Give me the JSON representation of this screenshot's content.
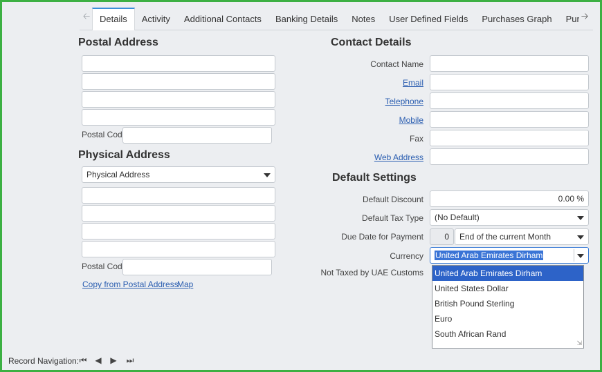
{
  "tabs": [
    "Details",
    "Activity",
    "Additional Contacts",
    "Banking Details",
    "Notes",
    "User Defined Fields",
    "Purchases Graph",
    "Purchase O"
  ],
  "postal": {
    "heading": "Postal Address",
    "postal_code_label": "Postal Code"
  },
  "physical": {
    "heading": "Physical Address",
    "select_value": "Physical Address",
    "postal_code_label": "Postal Code",
    "copy_link": "Copy from Postal Address",
    "map_link": "Map"
  },
  "contact": {
    "heading": "Contact Details",
    "contact_name_label": "Contact Name",
    "email_label": "Email",
    "telephone_label": "Telephone",
    "mobile_label": "Mobile",
    "fax_label": "Fax",
    "web_label": "Web Address"
  },
  "defaults": {
    "heading": "Default Settings",
    "discount_label": "Default Discount",
    "discount_value": "0.00 %",
    "tax_label": "Default Tax Type",
    "tax_value": "(No Default)",
    "due_label": "Due Date for Payment",
    "due_days": "0",
    "due_value": "End of the current Month",
    "currency_label": "Currency",
    "currency_value": "United Arab Emirates Dirham",
    "not_taxed_label": "Not Taxed by UAE Customs"
  },
  "currency_options": [
    "United Arab Emirates Dirham",
    "United States Dollar",
    "British Pound Sterling",
    "Euro",
    "South African Rand"
  ],
  "record_nav_label": "Record Navigation:",
  "icons": {
    "tab_left": "arrow-left-icon",
    "tab_right": "arrow-right-icon",
    "first": "first-record-icon",
    "prev": "previous-record-icon",
    "next": "next-record-icon",
    "last": "last-record-icon"
  }
}
